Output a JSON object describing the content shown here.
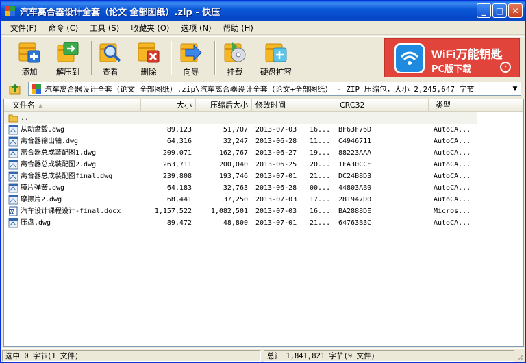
{
  "window": {
    "title": "汽车离合器设计全套（论文 全部图纸）.zip - 快压",
    "controls": {
      "minimize": "_",
      "maximize": "□",
      "close": "✕"
    }
  },
  "menu": [
    {
      "label": "文件(F)"
    },
    {
      "label": "命令 (C)"
    },
    {
      "label": "工具 (S)"
    },
    {
      "label": "收藏夹 (O)"
    },
    {
      "label": "选项 (N)"
    },
    {
      "label": "帮助 (H)"
    }
  ],
  "toolbar": {
    "buttons": [
      {
        "label": "添加",
        "icon": "add-archive-icon"
      },
      {
        "label": "解压到",
        "icon": "extract-to-icon"
      },
      {
        "label": "查看",
        "icon": "view-icon"
      },
      {
        "label": "删除",
        "icon": "delete-icon"
      },
      {
        "label": "向导",
        "icon": "wizard-icon"
      },
      {
        "label": "挂载",
        "icon": "mount-icon"
      },
      {
        "label": "硬盘扩容",
        "icon": "disk-expand-icon"
      }
    ]
  },
  "ad": {
    "title": "WiFi万能钥匙",
    "subtitle": "PC版下载",
    "color": "#e0443a"
  },
  "address": {
    "path": "汽车离合器设计全套（论文 全部图纸）.zip\\汽车离合器设计全套（论文+全部图纸） - ZIP 压缩包，大小 2,245,647 字节"
  },
  "columns": {
    "name": "文件名",
    "size": "大小",
    "packed": "压缩后大小",
    "modified": "修改时间",
    "crc": "CRC32",
    "type": "类型"
  },
  "parent_row": {
    "name": ".."
  },
  "files": [
    {
      "name": "从动盘毂.dwg",
      "size": "89,123",
      "packed": "51,707",
      "date": "2013-07-03",
      "time": "16...",
      "crc": "BF63F76D",
      "type": "AutoCA...",
      "kind": "dwg"
    },
    {
      "name": "离合器输出轴.dwg",
      "size": "64,316",
      "packed": "32,247",
      "date": "2013-06-28",
      "time": "11...",
      "crc": "C4946711",
      "type": "AutoCA...",
      "kind": "dwg"
    },
    {
      "name": "离合器总成装配图1.dwg",
      "size": "209,071",
      "packed": "162,767",
      "date": "2013-06-27",
      "time": "19...",
      "crc": "88223AAA",
      "type": "AutoCA...",
      "kind": "dwg"
    },
    {
      "name": "离合器总成装配图2.dwg",
      "size": "263,711",
      "packed": "200,040",
      "date": "2013-06-25",
      "time": "20...",
      "crc": "1FA30CCE",
      "type": "AutoCA...",
      "kind": "dwg"
    },
    {
      "name": "离合器总成装配图final.dwg",
      "size": "239,808",
      "packed": "193,746",
      "date": "2013-07-01",
      "time": "21...",
      "crc": "DC24B8D3",
      "type": "AutoCA...",
      "kind": "dwg"
    },
    {
      "name": "膜片弹簧.dwg",
      "size": "64,183",
      "packed": "32,763",
      "date": "2013-06-28",
      "time": "00...",
      "crc": "44803AB0",
      "type": "AutoCA...",
      "kind": "dwg"
    },
    {
      "name": "摩擦片2.dwg",
      "size": "68,441",
      "packed": "37,250",
      "date": "2013-07-03",
      "time": "17...",
      "crc": "281947D0",
      "type": "AutoCA...",
      "kind": "dwg"
    },
    {
      "name": "汽车设计课程设计-final.docx",
      "size": "1,157,522",
      "packed": "1,082,501",
      "date": "2013-07-03",
      "time": "16...",
      "crc": "BA2888DE",
      "type": "Micros...",
      "kind": "docx"
    },
    {
      "name": "压盘.dwg",
      "size": "89,472",
      "packed": "48,800",
      "date": "2013-07-01",
      "time": "21...",
      "crc": "64763B3C",
      "type": "AutoCA...",
      "kind": "dwg"
    }
  ],
  "status": {
    "selected": "选中  0 字节(1 文件)",
    "total": "总计  1,841,821 字节(9 文件)"
  }
}
